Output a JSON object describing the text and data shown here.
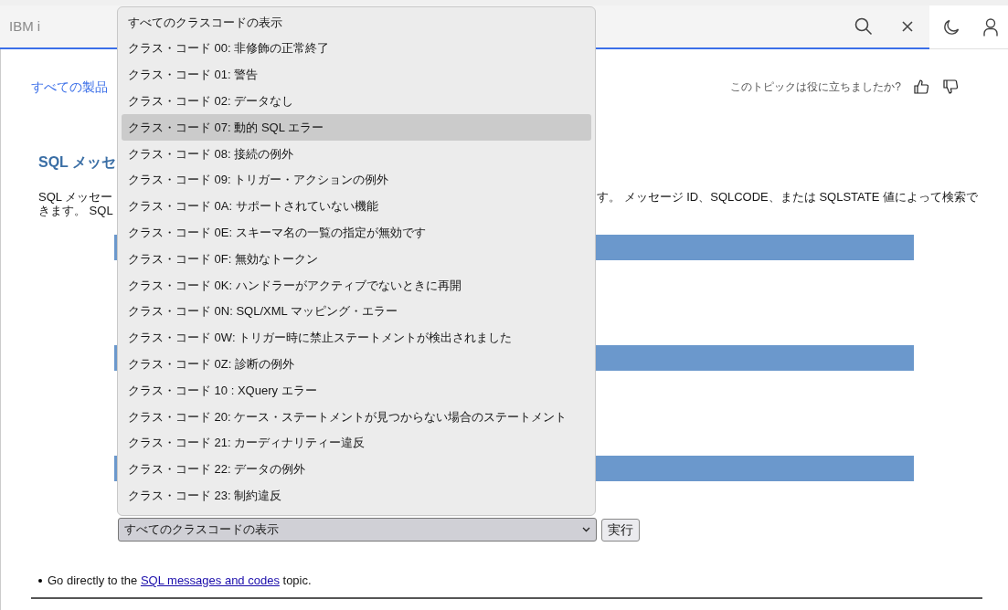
{
  "header": {
    "title": "IBM i"
  },
  "breadcrumb": {
    "link": "すべての製品"
  },
  "feedback": {
    "question": "このトピックは役に立ちましたか?"
  },
  "heading": "SQL メッセ",
  "intro": {
    "line1_start": "SQL メッセー",
    "line1_end": "す。 メッセージ ID、SQLCODE、または SQLSTATE 値によって検索で",
    "line2_start": "きます。 SQL"
  },
  "class_select": {
    "value": "すべてのクラスコードの表示",
    "expanded": true,
    "options": [
      {
        "label": "すべてのクラスコードの表示",
        "highlighted": false
      },
      {
        "label": "クラス・コード 00: 非修飾の正常終了",
        "highlighted": false
      },
      {
        "label": "クラス・コード 01: 警告",
        "highlighted": false
      },
      {
        "label": "クラス・コード 02: データなし",
        "highlighted": false
      },
      {
        "label": "クラス・コード 07: 動的 SQL エラー",
        "highlighted": true
      },
      {
        "label": "クラス・コード 08: 接続の例外",
        "highlighted": false
      },
      {
        "label": "クラス・コード 09: トリガー・アクションの例外",
        "highlighted": false
      },
      {
        "label": "クラス・コード 0A: サポートされていない機能",
        "highlighted": false
      },
      {
        "label": "クラス・コード 0E: スキーマ名の一覧の指定が無効です",
        "highlighted": false
      },
      {
        "label": "クラス・コード 0F: 無効なトークン",
        "highlighted": false
      },
      {
        "label": "クラス・コード 0K: ハンドラーがアクティブでないときに再開",
        "highlighted": false
      },
      {
        "label": "クラス・コード 0N: SQL/XML マッピング・エラー",
        "highlighted": false
      },
      {
        "label": "クラス・コード 0W: トリガー時に禁止ステートメントが検出されました",
        "highlighted": false
      },
      {
        "label": "クラス・コード 0Z: 診断の例外",
        "highlighted": false
      },
      {
        "label": "クラス・コード 10 : XQuery エラー",
        "highlighted": false
      },
      {
        "label": "クラス・コード 20: ケース・ステートメントが見つからない場合のステートメント",
        "highlighted": false
      },
      {
        "label": "クラス・コード 21: カーディナリティー違反",
        "highlighted": false
      },
      {
        "label": "クラス・コード 22: データの例外",
        "highlighted": false
      },
      {
        "label": "クラス・コード 23: 制約違反",
        "highlighted": false
      }
    ]
  },
  "run_button": "実行",
  "bullet": {
    "before": "Go directly to the",
    "link": "SQL messages and codes",
    "after": "topic."
  }
}
